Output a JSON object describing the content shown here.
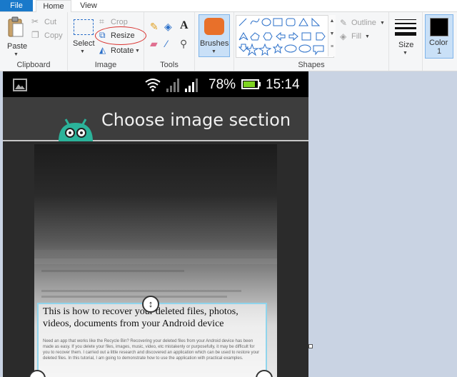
{
  "tabs": {
    "file": "File",
    "home": "Home",
    "view": "View"
  },
  "clipboard": {
    "paste": "Paste",
    "cut": "Cut",
    "copy": "Copy",
    "label": "Clipboard"
  },
  "image": {
    "select": "Select",
    "crop": "Crop",
    "resize": "Resize",
    "rotate": "Rotate",
    "label": "Image"
  },
  "tools": {
    "label": "Tools"
  },
  "brushes": {
    "label": "Brushes"
  },
  "shapes": {
    "outline": "Outline",
    "fill": "Fill",
    "label": "Shapes"
  },
  "size": {
    "label": "Size"
  },
  "color1": {
    "label_line1": "Color",
    "label_line2": "1"
  },
  "phone": {
    "battery": "78%",
    "time": "15:14",
    "title": "Choose image section",
    "article_title": "This is how to recover your deleted files, photos, videos, documents from your Android device",
    "article_snippet": "Need an app that works like the Recycle Bin? Recovering your deleted files from your Android device has been made as easy. If you delete your files, images, music, video, etc mistakenly or purposefully, it may be difficult for you to recover them. I carried out a little research and discovered an application which can be used to restore your deleted files. In this tutorial, I am going to demonstrate how to use the application with practical examples."
  },
  "colors": {
    "accent": "#1979ca",
    "ribbon": "#f5f6f7",
    "workspace": "#c9d3e3",
    "resize_highlight": "#d9302c",
    "crop_border": "#8fd4ec"
  }
}
